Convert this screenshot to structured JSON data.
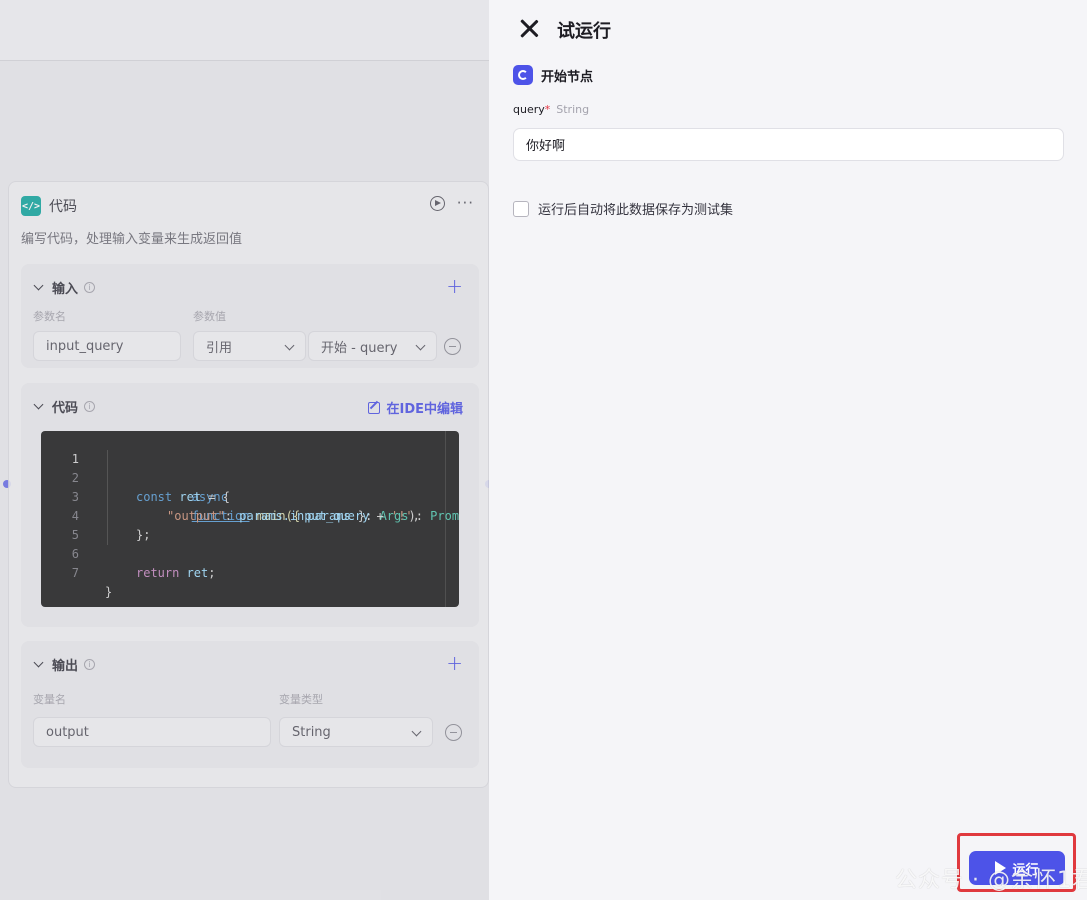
{
  "canvas": {
    "node": {
      "title": "代码",
      "description": "编写代码，处理输入变量来生成返回值",
      "input_section": {
        "title": "输入",
        "col_name": "参数名",
        "col_value": "参数值",
        "param_name": "input_query",
        "value_type": "引用",
        "value_ref": "开始 - query"
      },
      "code_section": {
        "title": "代码",
        "ide_link": "在IDE中编辑",
        "lines": [
          {
            "n": "1"
          },
          {
            "n": "2"
          },
          {
            "n": "3"
          },
          {
            "n": "4"
          },
          {
            "n": "5"
          },
          {
            "n": "6"
          },
          {
            "n": "7"
          }
        ],
        "code": {
          "l1_kw": "async",
          "l1_fn": "function",
          "l1_name": " main({ ",
          "l1_param": "params",
          "l1_mid": " }: ",
          "l1_type": "Args",
          "l1_end": "): ",
          "l1_ret": "Promise",
          "l2_kw": "const",
          "l2_var": " ret",
          "l2_end": " = {",
          "l3_key": "\"output\"",
          "l3_mid": ": ",
          "l3_expr": "params.input_query",
          "l3_plus": " + ",
          "l3_str": "'!'",
          "l3_end": ",",
          "l4": "};",
          "l6_kw": "return",
          "l6_var": " ret",
          "l6_end": ";",
          "l7": "}"
        }
      },
      "output_section": {
        "title": "输出",
        "col_name": "变量名",
        "col_type": "变量类型",
        "var_name": "output",
        "var_type": "String"
      }
    }
  },
  "panel": {
    "title": "试运行",
    "start_node_label": "开始节点",
    "query_label": "query",
    "query_required_mark": "*",
    "query_type": "String",
    "query_value": "你好啊",
    "save_checkbox_label": "运行后自动将此数据保存为测试集",
    "run_button": "运行"
  },
  "watermark": "公众号 · @余怀1君",
  "colors": {
    "accent": "#4d53e8",
    "highlight_border": "#e0393e",
    "code_bg": "#1e1e1f"
  }
}
